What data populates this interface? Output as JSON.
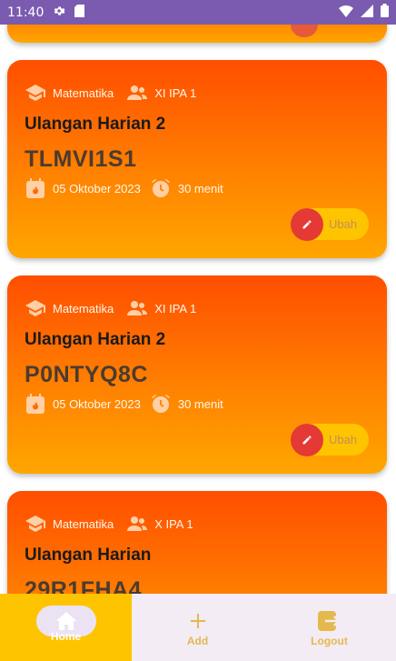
{
  "status_bar": {
    "time": "11:40"
  },
  "cards": [
    {
      "subject": "Matematika",
      "class": "XI IPA 1",
      "title": "Ulangan Harian 2",
      "code": "TLMVI1S1",
      "date": "05 Oktober 2023",
      "duration": "30 menit",
      "edit_label": "Ubah"
    },
    {
      "subject": "Matematika",
      "class": "XI IPA 1",
      "title": "Ulangan Harian 2",
      "code": "P0NTYQ8C",
      "date": "05 Oktober 2023",
      "duration": "30 menit",
      "edit_label": "Ubah"
    },
    {
      "subject": "Matematika",
      "class": "X IPA 1",
      "title": "Ulangan Harian",
      "code": "29R1FHA4"
    }
  ],
  "bottom_nav": [
    {
      "label": "Home",
      "icon": "home-icon",
      "active": true
    },
    {
      "label": "Add",
      "icon": "add-icon",
      "active": false
    },
    {
      "label": "Logout",
      "icon": "logout-icon",
      "active": false
    }
  ],
  "colors": {
    "accent": "#ffc400",
    "card_gradient_top": "#ff4e00",
    "card_gradient_bottom": "#ffa600",
    "edit_button": "#e53935",
    "status_bar": "#7a5bb0",
    "nav_background": "#f3ecf5"
  }
}
